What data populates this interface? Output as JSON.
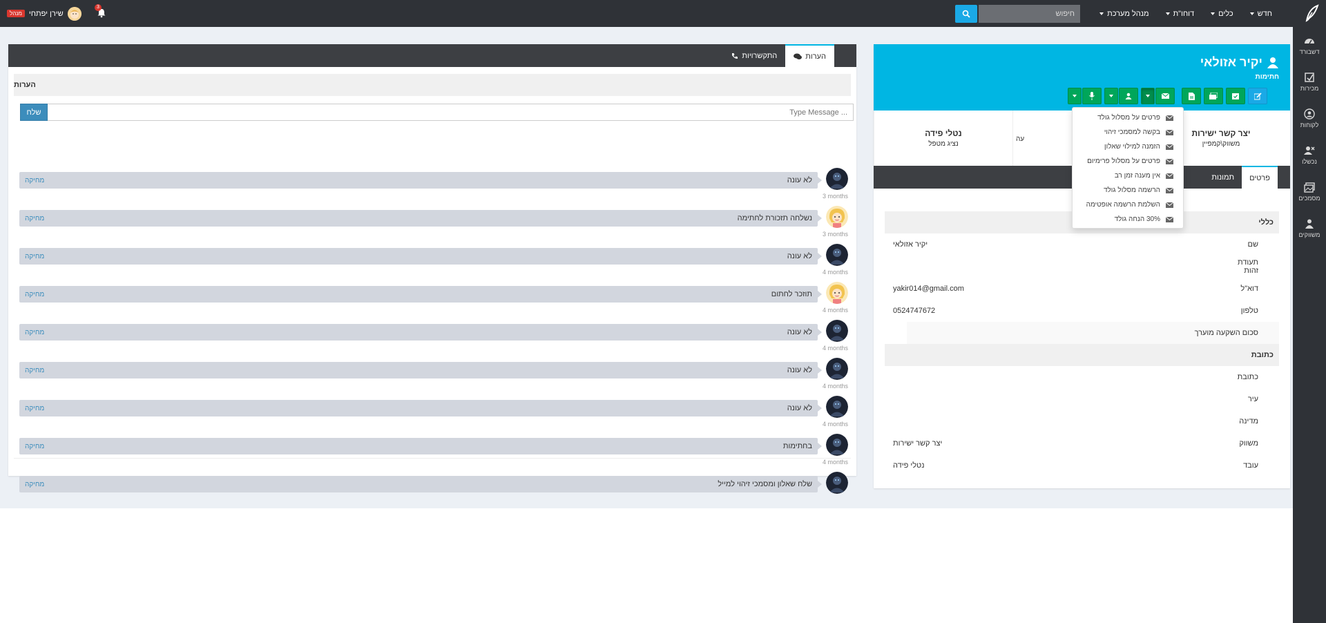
{
  "topbar": {
    "nav": [
      {
        "label": "חדש"
      },
      {
        "label": "כלים"
      },
      {
        "label": "דוחו\"ת"
      },
      {
        "label": "מנהל מערכת"
      }
    ],
    "search_placeholder": "חיפוש",
    "notification_count": "3",
    "user_name": "שירן יפתחי",
    "user_badge": "מנהל"
  },
  "sidebar": {
    "items": [
      {
        "label": "דשבורד",
        "icon": "dashboard-icon"
      },
      {
        "label": "מכירות",
        "icon": "sales-icon"
      },
      {
        "label": "לקוחות",
        "icon": "customers-icon"
      },
      {
        "label": "נכשלו",
        "icon": "failed-icon"
      },
      {
        "label": "מסמכים",
        "icon": "documents-icon"
      },
      {
        "label": "משווקים",
        "icon": "marketers-icon"
      }
    ]
  },
  "profile": {
    "name": "יקיר אזולאי",
    "status": "חתימות",
    "stats": [
      {
        "value": "יצר קשר ישירות",
        "label": "משווק\\קמפיין"
      },
      {
        "value": "",
        "label": "עה"
      },
      {
        "value": "נטלי פידה",
        "label": "נציג מטפל"
      }
    ],
    "tabs": [
      {
        "label": "פרטים"
      },
      {
        "label": "תמונות"
      }
    ],
    "sections": {
      "general_title": "כללי",
      "address_title": "כתובת"
    },
    "general": [
      {
        "key": "שם",
        "value": "יקיר אזולאי"
      },
      {
        "key": "תעודת זהות",
        "value": ""
      },
      {
        "key": "דוא\"ל",
        "value": "yakir014@gmail.com"
      },
      {
        "key": "טלפון",
        "value": "0524747672"
      },
      {
        "key": "סכום השקעה מוערך",
        "value": ""
      }
    ],
    "address": [
      {
        "key": "כתובת",
        "value": ""
      },
      {
        "key": "עיר",
        "value": ""
      },
      {
        "key": "מדינה",
        "value": ""
      },
      {
        "key": "משווק",
        "value": "יצר קשר ישירות"
      },
      {
        "key": "עובד",
        "value": "נטלי פידה"
      }
    ]
  },
  "email_dropdown": [
    "פרטים על מסלול גולד",
    "בקשה למסמכי זיהוי",
    "הזמנה למילוי שאלון",
    "פרטים על מסלול פרימיום",
    "אין מענה זמן רב",
    "הרשמה מסלול גולד",
    "השלמת הרשמה אופטימה",
    "30% הנחה גולד"
  ],
  "notes": {
    "tabs": [
      {
        "label": "הערות",
        "icon": "comments-icon"
      },
      {
        "label": "התקשרויות",
        "icon": "phone-icon"
      }
    ],
    "title": "הערות",
    "input_placeholder": "Type Message ...",
    "send_label": "שלח",
    "delete_label": "מחיקה",
    "items": [
      {
        "text": "לא עונה",
        "time": "3 months",
        "avatar": "dark"
      },
      {
        "text": "נשלחה תזכורת לחתימה",
        "time": "3 months",
        "avatar": "blonde"
      },
      {
        "text": "לא עונה",
        "time": "4 months",
        "avatar": "dark"
      },
      {
        "text": "תוזכר לחתום",
        "time": "4 months",
        "avatar": "blonde"
      },
      {
        "text": "לא עונה",
        "time": "4 months",
        "avatar": "dark"
      },
      {
        "text": "לא עונה",
        "time": "4 months",
        "avatar": "dark"
      },
      {
        "text": "לא עונה",
        "time": "4 months",
        "avatar": "dark"
      },
      {
        "text": "בחתימות",
        "time": "4 months",
        "avatar": "dark"
      },
      {
        "text": "שלח שאלון ומסמכי זיהוי למייל",
        "time": "",
        "avatar": "dark"
      }
    ]
  },
  "colors": {
    "topbar": "#2f3237",
    "accent": "#00b6e3",
    "green": "#00a65a",
    "link": "#3c8dbc"
  }
}
